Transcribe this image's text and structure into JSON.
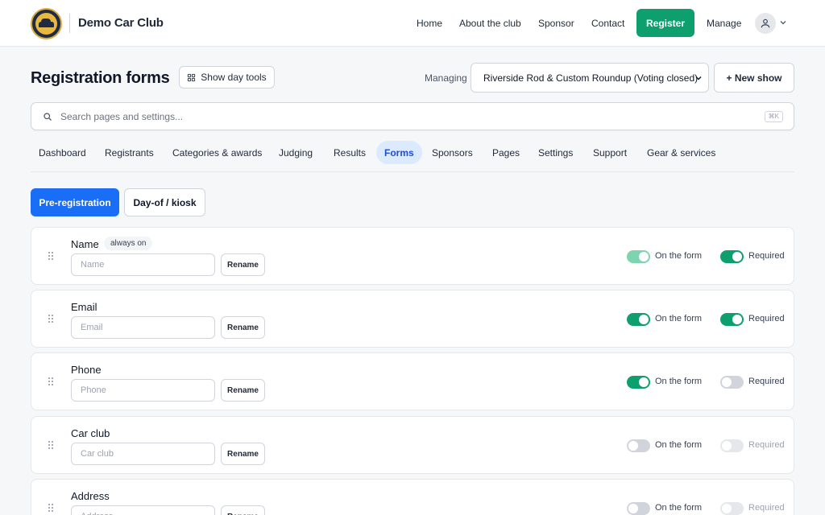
{
  "header": {
    "brand": "Demo Car Club",
    "nav": [
      {
        "label": "Home"
      },
      {
        "label": "About the club"
      },
      {
        "label": "Sponsor"
      },
      {
        "label": "Contact"
      }
    ],
    "register_label": "Register",
    "manage_label": "Manage"
  },
  "toolbar": {
    "title": "Registration forms",
    "day_tools_label": "Show day tools",
    "managing_label": "Managing",
    "selected_show": "Riverside Rod & Custom Roundup (Voting closed)",
    "new_show_label": "+ New show"
  },
  "search": {
    "placeholder": "Search pages and settings...",
    "shortcut": "⌘K"
  },
  "tabs": [
    {
      "label": "Dashboard"
    },
    {
      "label": "Registrants"
    },
    {
      "label": "Categories & awards"
    },
    {
      "label": "Judging"
    },
    {
      "label": "Results"
    },
    {
      "label": "Forms",
      "active": true
    },
    {
      "label": "Sponsors"
    },
    {
      "label": "Pages"
    },
    {
      "label": "Settings"
    },
    {
      "label": "Support"
    },
    {
      "label": "Gear & services"
    }
  ],
  "form_modes": {
    "pre_registration": "Pre-registration",
    "day_of": "Day-of / kiosk"
  },
  "field_labels": {
    "rename": "Rename",
    "on_form": "On the form",
    "required": "Required",
    "always_on": "always on"
  },
  "fields": [
    {
      "name": "Name",
      "placeholder": "Name",
      "on_form": true,
      "required": true,
      "always_on": true
    },
    {
      "name": "Email",
      "placeholder": "Email",
      "on_form": true,
      "required": true
    },
    {
      "name": "Phone",
      "placeholder": "Phone",
      "on_form": true,
      "required": false
    },
    {
      "name": "Car club",
      "placeholder": "Car club",
      "on_form": false,
      "required": false
    },
    {
      "name": "Address",
      "placeholder": "Address",
      "on_form": false,
      "required": false
    }
  ],
  "colors": {
    "accent_green": "#0e9f6e",
    "primary_blue": "#1a6ef5",
    "tab_active_bg": "#dbeafe"
  }
}
